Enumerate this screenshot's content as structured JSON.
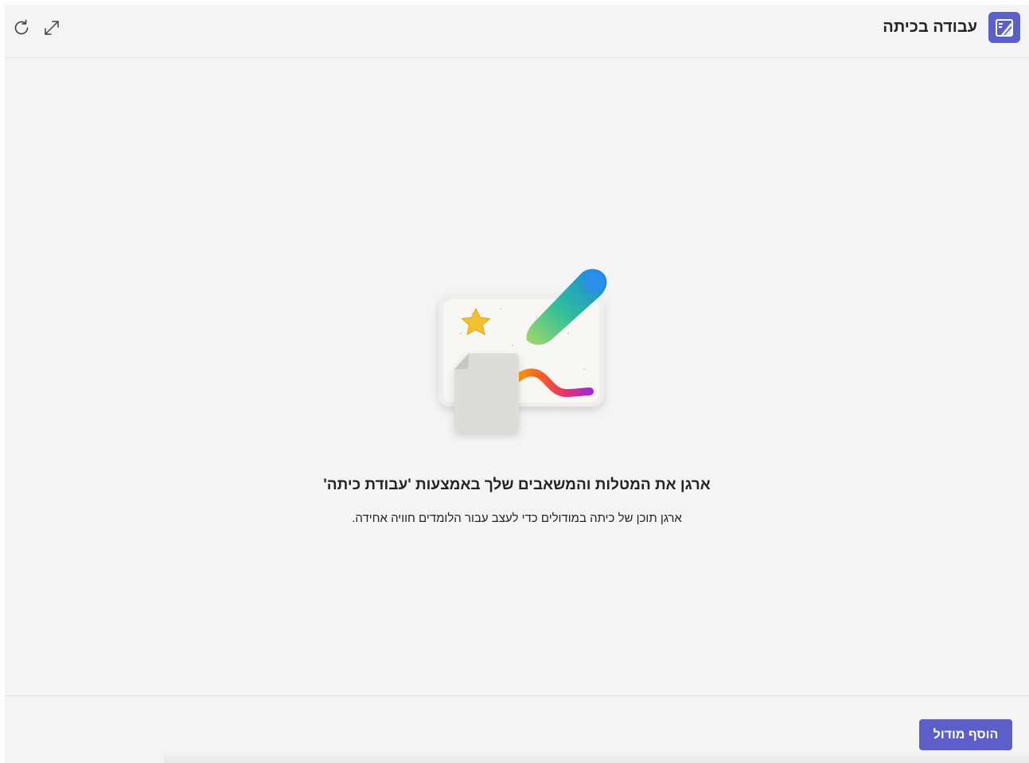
{
  "header": {
    "app_title": "עבודה בכיתה",
    "icons": [
      "notebook-app-icon",
      "refresh-icon",
      "expand-icon"
    ]
  },
  "empty_state": {
    "title": "ארגן את המטלות והמשאבים שלך באמצעות 'עבודת כיתה'",
    "description": "ארגן תוכן של כיתה במודולים כדי לעצב עבור הלומדים חוויה אחידה.",
    "illustration": "classwork-illustration"
  },
  "footer": {
    "add_module_label": "הוסף מודול"
  },
  "colors": {
    "accent": "#5b5fc7",
    "background": "#f4f4f4",
    "text": "#242424"
  }
}
